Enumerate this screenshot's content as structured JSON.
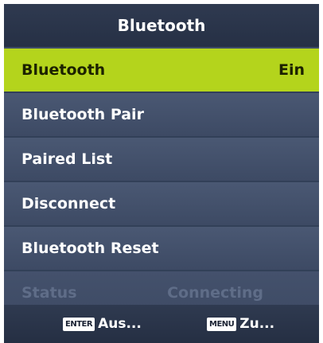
{
  "header": {
    "title": "Bluetooth"
  },
  "menu": {
    "items": [
      {
        "label": "Bluetooth",
        "value": "Ein"
      },
      {
        "label": "Bluetooth Pair"
      },
      {
        "label": "Paired List"
      },
      {
        "label": "Disconnect"
      },
      {
        "label": "Bluetooth Reset"
      },
      {
        "label": "Status",
        "value": "Connecting"
      }
    ]
  },
  "footer": {
    "enter_key": "ENTER",
    "enter_label": "Aus...",
    "menu_key": "MENU",
    "menu_label": "Zu..."
  },
  "colors": {
    "selected_bg": "#b4d41c",
    "panel_bg": "#3f4c66",
    "disabled_text": "#5f6d88"
  }
}
